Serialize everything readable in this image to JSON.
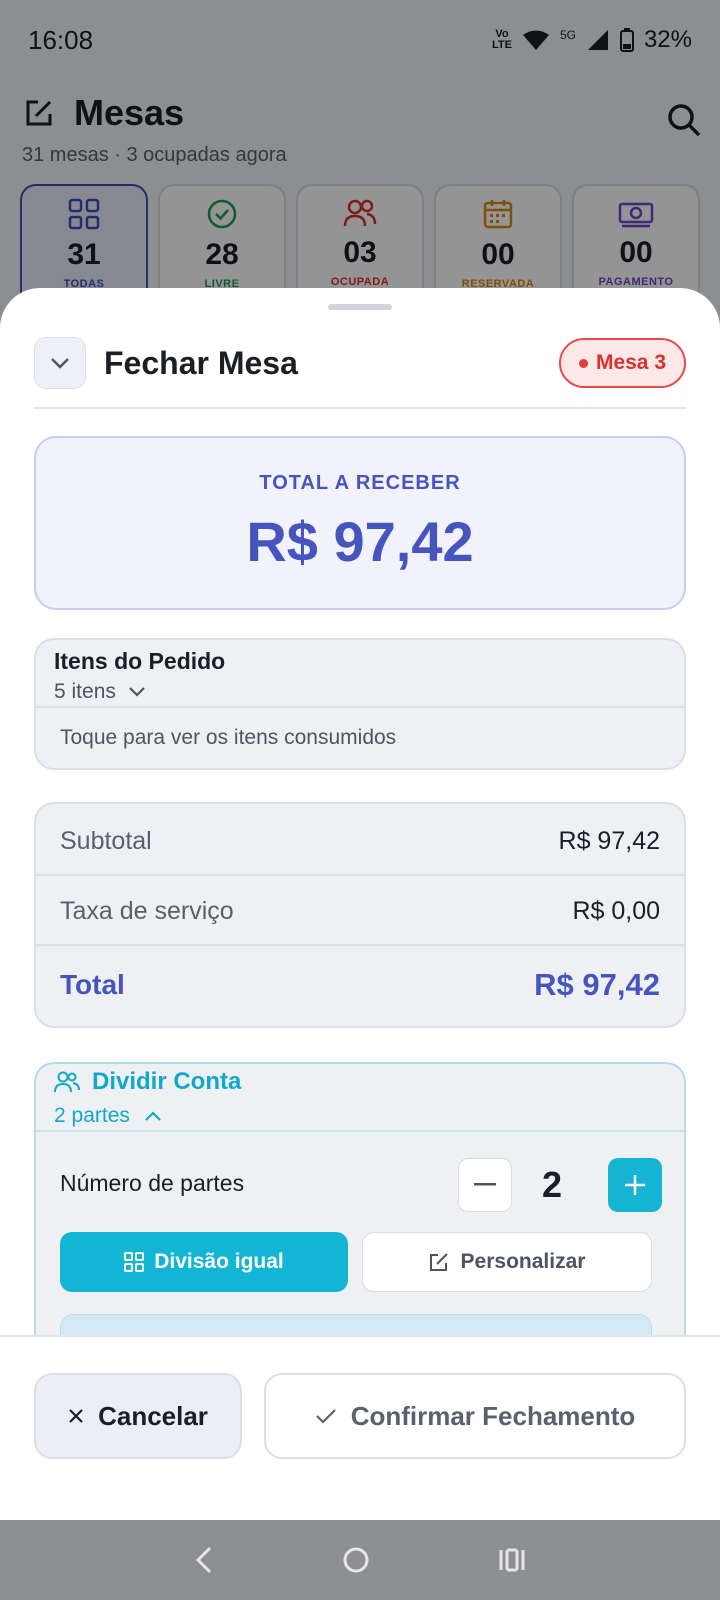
{
  "status_bar": {
    "time": "16:08",
    "volte_top": "Vo",
    "volte_bottom": "LTE",
    "network": "5G",
    "battery": "32%"
  },
  "screen": {
    "title": "Mesas",
    "subtitle": "31 mesas · 3 ocupadas agora",
    "stats": [
      {
        "value": "31",
        "label": "TODAS",
        "color": "#3e4fb8",
        "icon": "grid-icon"
      },
      {
        "value": "28",
        "label": "LIVRE",
        "color": "#1f9d55",
        "icon": "check-circle-icon"
      },
      {
        "value": "03",
        "label": "OCUPADA",
        "color": "#d93030",
        "icon": "users-icon"
      },
      {
        "value": "00",
        "label": "RESERVADA",
        "color": "#d98a12",
        "icon": "calendar-icon"
      },
      {
        "value": "00",
        "label": "PAGAMENTO",
        "color": "#6f45c8",
        "icon": "money-icon"
      }
    ]
  },
  "sheet": {
    "title": "Fechar Mesa",
    "badge": "Mesa 3",
    "total_label": "TOTAL A RECEBER",
    "total_value": "R$ 97,42",
    "items": {
      "title": "Itens do Pedido",
      "count": "5 itens",
      "hint": "Toque para ver os itens consumidos"
    },
    "summary": {
      "subtotal_label": "Subtotal",
      "subtotal_value": "R$ 97,42",
      "service_label": "Taxa de serviço",
      "service_value": "R$ 0,00",
      "total_label": "Total",
      "total_value": "R$ 97,42"
    },
    "split": {
      "title": "Dividir Conta",
      "parts_summary": "2 partes",
      "parts_label": "Número de partes",
      "parts_value": "2",
      "equal_label": "Divisão igual",
      "custom_label": "Personalizar"
    },
    "footer": {
      "cancel": "Cancelar",
      "confirm": "Confirmar Fechamento"
    }
  },
  "colors": {
    "accent": "#4654bd",
    "teal": "#12b5d4",
    "danger": "#d93030"
  }
}
